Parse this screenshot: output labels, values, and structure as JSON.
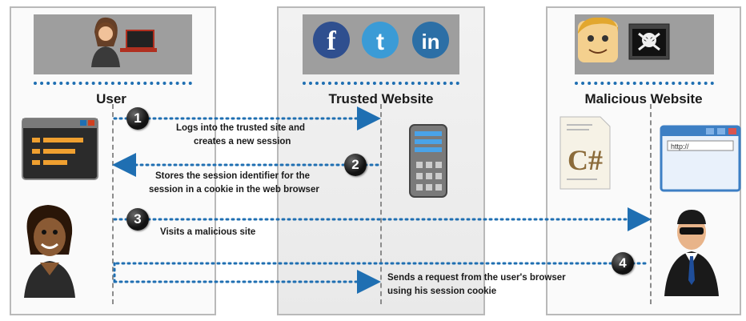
{
  "columns": {
    "user": "User",
    "trusted": "Trusted Website",
    "malicious": "Malicious Website"
  },
  "steps": [
    {
      "num": "1",
      "text_line1": "Logs into the trusted site and",
      "text_line2": "creates a new session"
    },
    {
      "num": "2",
      "text_line1": "Stores the session identifier for the",
      "text_line2": "session in a cookie in the web browser"
    },
    {
      "num": "3",
      "text_line1": "Visits a malicious site",
      "text_line2": ""
    },
    {
      "num": "4",
      "text_line1": "Sends a request from the user's browser",
      "text_line2": "using his session cookie"
    }
  ],
  "icons": {
    "social": [
      "f",
      "t",
      "in"
    ],
    "code_label": "C#",
    "browser_url": "http://"
  },
  "colors": {
    "arrow": "#1f6fb2",
    "header_bar": "#9e9e9e"
  }
}
